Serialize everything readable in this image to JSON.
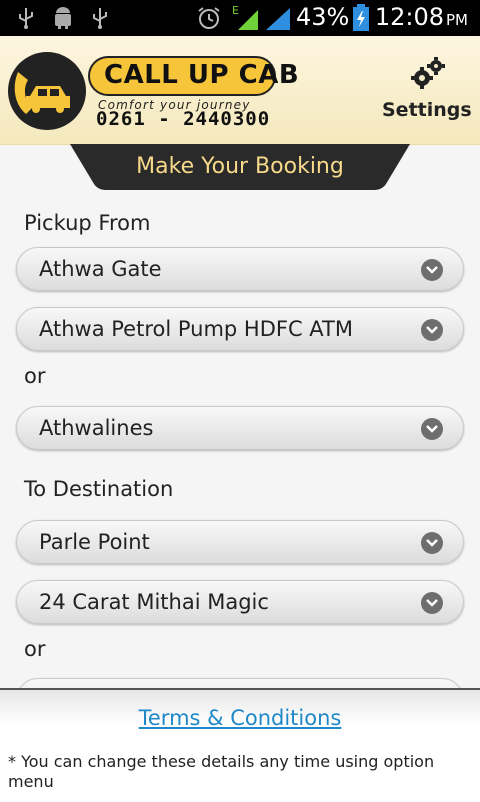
{
  "status_bar": {
    "battery_percent": "43%",
    "time": "12:08",
    "ampm": "PM",
    "network_type": "E",
    "icons": [
      "usb-icon",
      "android-debug-icon",
      "usb-icon",
      "alarm-icon",
      "signal-icon",
      "signal-icon",
      "battery-charging-icon"
    ]
  },
  "header": {
    "logo_title": "CALL UP CAB",
    "logo_tagline": "Comfort your journey",
    "logo_phone": "0261 - 2440300",
    "settings_label": "Settings",
    "settings_icon": "gears-icon"
  },
  "booking": {
    "tab_title": "Make Your Booking",
    "pickup_label": "Pickup From",
    "pickup_area": "Athwa Gate",
    "pickup_landmark": "Athwa Petrol Pump HDFC ATM",
    "or_label": "or",
    "pickup_alt": "Athwalines",
    "destination_label": "To Destination",
    "destination_area": "Parle Point",
    "destination_landmark": "24 Carat Mithai Magic",
    "or_label_2": "or"
  },
  "footer": {
    "terms_link": "Terms & Conditions",
    "note": "* You can change these details any time using option menu"
  },
  "colors": {
    "header_bg": "#fdf6e0",
    "logo_yellow": "#f7c53a",
    "tab_dark": "#2a2a2a",
    "tab_text": "#f7d98a",
    "link_blue": "#1e88c8"
  }
}
